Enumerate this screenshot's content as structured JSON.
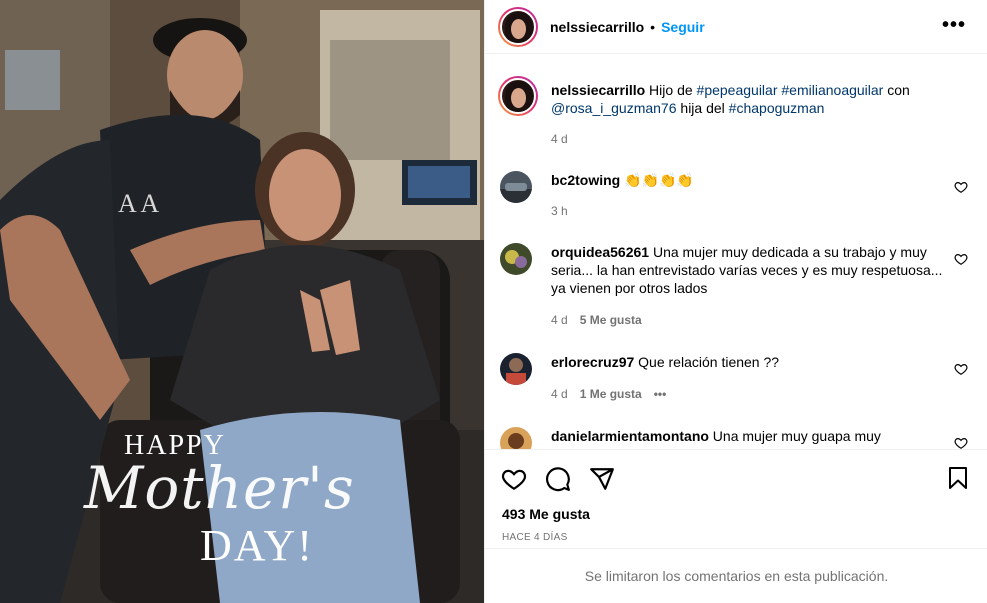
{
  "post": {
    "overlay": {
      "happy": "HAPPY",
      "mothers": "Mother's",
      "day": "DAY!"
    }
  },
  "header": {
    "username": "nelssiecarrillo",
    "separator": "•",
    "follow_label": "Seguir",
    "more_label": "•••"
  },
  "caption": {
    "username": "nelssiecarrillo",
    "text_1": " Hijo de ",
    "tag_1": "#pepeaguilar",
    "tag_2": "#emilianoaguilar",
    "text_2": " con ",
    "tag_3": "@rosa_i_guzman76",
    "text_3": " hija del ",
    "tag_4": "#chapoguzman",
    "time": "4 d"
  },
  "comments": [
    {
      "username": "bc2towing",
      "text": " 👏👏👏👏",
      "time": "3 h",
      "likes": "",
      "more": ""
    },
    {
      "username": "orquidea56261",
      "text": " Una mujer muy dedicada a su trabajo y muy seria... la han entrevistado varías veces y es muy respetuosa... ya vienen por otros lados",
      "time": "4 d",
      "likes": "5 Me gusta",
      "more": ""
    },
    {
      "username": "erlorecruz97",
      "text": " Que relación tienen ??",
      "time": "4 d",
      "likes": "1 Me gusta",
      "more": "•••"
    },
    {
      "username": "danielarmientamontano",
      "text": " Una mujer muy guapa muy",
      "time": "",
      "likes": "",
      "more": ""
    }
  ],
  "footer": {
    "likes": "493 Me gusta",
    "ago": "HACE 4 DÍAS",
    "limited": "Se limitaron los comentarios en esta publicación."
  },
  "icons": {
    "like": "heart-icon",
    "comment": "comment-icon",
    "share": "share-icon",
    "save": "bookmark-icon",
    "more": "more-options-icon"
  },
  "colors": {
    "link": "#0095f6",
    "tag": "#00376b",
    "muted": "#737373",
    "divider": "#efefef"
  }
}
